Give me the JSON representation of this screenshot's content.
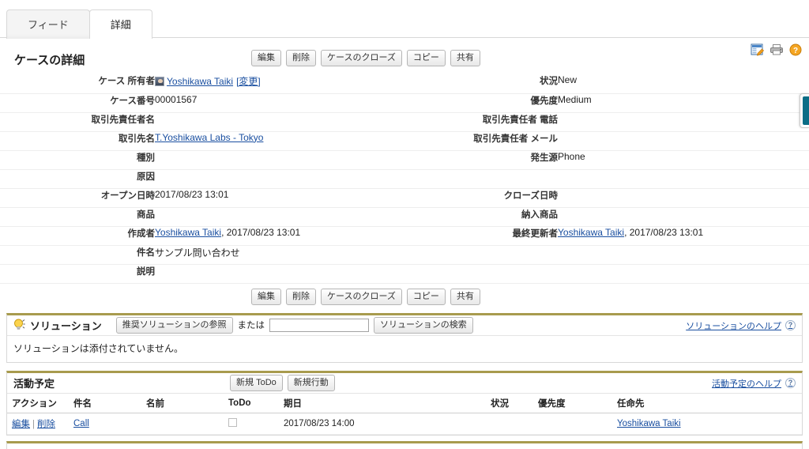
{
  "tabs": [
    {
      "label": "フィード",
      "active": false
    },
    {
      "label": "詳細",
      "active": true
    }
  ],
  "top_icons": [
    {
      "name": "edit-layout-icon",
      "title": "ページレイアウトの編集"
    },
    {
      "name": "print-icon",
      "title": "印刷"
    },
    {
      "name": "help-icon",
      "title": "ヘルプ"
    }
  ],
  "detail": {
    "title": "ケースの詳細",
    "buttons": [
      "編集",
      "削除",
      "ケースのクローズ",
      "コピー",
      "共有"
    ],
    "rows": [
      {
        "left_label": "ケース 所有者",
        "left_value": "Yoshikawa Taiki",
        "left_type": "owner",
        "left_extra": "[変更]",
        "right_label": "状況",
        "right_value": "New",
        "right_type": "text"
      },
      {
        "left_label": "ケース番号",
        "left_value": "00001567",
        "left_type": "text",
        "right_label": "優先度",
        "right_value": "Medium",
        "right_type": "text"
      },
      {
        "left_label": "取引先責任者名",
        "left_value": "",
        "left_type": "text",
        "right_label": "取引先責任者 電話",
        "right_value": "",
        "right_type": "text"
      },
      {
        "left_label": "取引先名",
        "left_value": "T.Yoshikawa Labs - Tokyo",
        "left_type": "link",
        "right_label": "取引先責任者 メール",
        "right_value": "",
        "right_type": "text"
      },
      {
        "left_label": "種別",
        "left_value": "",
        "left_type": "text",
        "right_label": "発生源",
        "right_value": "Phone",
        "right_type": "text"
      },
      {
        "left_label": "原因",
        "left_value": "",
        "left_type": "text",
        "right_label": "",
        "right_value": "",
        "right_type": "text"
      },
      {
        "left_label": "オープン日時",
        "left_value": "2017/08/23 13:01",
        "left_type": "text",
        "right_label": "クローズ日時",
        "right_value": "",
        "right_type": "text"
      },
      {
        "left_label": "商品",
        "left_value": "",
        "left_type": "text",
        "right_label": "納入商品",
        "right_value": "",
        "right_type": "text"
      },
      {
        "left_label": "作成者",
        "left_value": "Yoshikawa Taiki",
        "left_type": "link",
        "left_suffix": ", 2017/08/23 13:01",
        "right_label": "最終更新者",
        "right_value": "Yoshikawa Taiki",
        "right_type": "link",
        "right_suffix": ", 2017/08/23 13:01"
      },
      {
        "left_label": "件名",
        "left_value": "サンプル問い合わせ",
        "left_type": "text",
        "right_label": "",
        "right_value": "",
        "right_type": "text"
      },
      {
        "left_label": "説明",
        "left_value": "",
        "left_type": "text",
        "right_label": "",
        "right_value": "",
        "right_type": "text"
      }
    ]
  },
  "solutions": {
    "title": "ソリューション",
    "browse_button": "推奨ソリューションの参照",
    "or_label": "または",
    "search_value": "",
    "search_placeholder": "",
    "search_button": "ソリューションの検索",
    "help_label": "ソリューションのヘルプ",
    "help_icon": "question-mark-icon",
    "empty_message": "ソリューションは添付されていません。"
  },
  "activities": {
    "title": "活動予定",
    "buttons": [
      "新規 ToDo",
      "新規行動"
    ],
    "help_label": "活動予定のヘルプ",
    "help_icon": "question-mark-icon",
    "columns": [
      "アクション",
      "件名",
      "名前",
      "ToDo",
      "期日",
      "状況",
      "優先度",
      "任命先"
    ],
    "rows": [
      {
        "action_edit": "編集",
        "action_sep": "|",
        "action_delete": "削除",
        "subject": "Call",
        "name": "",
        "todo_checked": false,
        "due_date": "2017/08/23 14:00",
        "status": "",
        "priority": "",
        "assigned_to": "Yoshikawa Taiki"
      }
    ]
  },
  "colors": {
    "section_accent": "#a89b4e",
    "link": "#1a4fa0",
    "side_tab": "#0a6d86"
  }
}
